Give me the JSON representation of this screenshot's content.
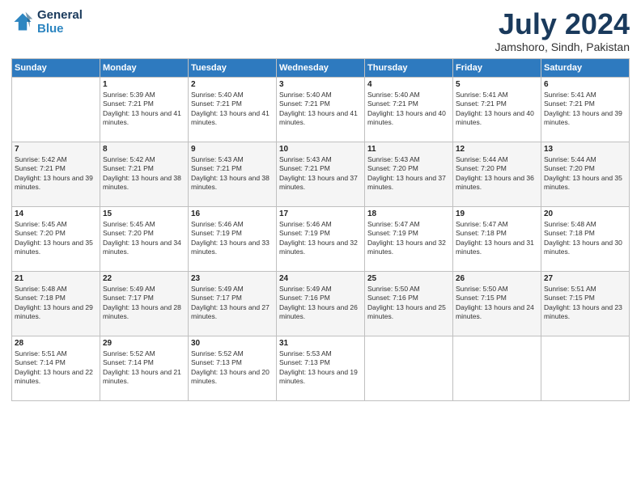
{
  "logo": {
    "line1": "General",
    "line2": "Blue"
  },
  "title": "July 2024",
  "subtitle": "Jamshoro, Sindh, Pakistan",
  "columns": [
    "Sunday",
    "Monday",
    "Tuesday",
    "Wednesday",
    "Thursday",
    "Friday",
    "Saturday"
  ],
  "weeks": [
    [
      {
        "day": "",
        "sunrise": "",
        "sunset": "",
        "daylight": ""
      },
      {
        "day": "1",
        "sunrise": "Sunrise: 5:39 AM",
        "sunset": "Sunset: 7:21 PM",
        "daylight": "Daylight: 13 hours and 41 minutes."
      },
      {
        "day": "2",
        "sunrise": "Sunrise: 5:40 AM",
        "sunset": "Sunset: 7:21 PM",
        "daylight": "Daylight: 13 hours and 41 minutes."
      },
      {
        "day": "3",
        "sunrise": "Sunrise: 5:40 AM",
        "sunset": "Sunset: 7:21 PM",
        "daylight": "Daylight: 13 hours and 41 minutes."
      },
      {
        "day": "4",
        "sunrise": "Sunrise: 5:40 AM",
        "sunset": "Sunset: 7:21 PM",
        "daylight": "Daylight: 13 hours and 40 minutes."
      },
      {
        "day": "5",
        "sunrise": "Sunrise: 5:41 AM",
        "sunset": "Sunset: 7:21 PM",
        "daylight": "Daylight: 13 hours and 40 minutes."
      },
      {
        "day": "6",
        "sunrise": "Sunrise: 5:41 AM",
        "sunset": "Sunset: 7:21 PM",
        "daylight": "Daylight: 13 hours and 39 minutes."
      }
    ],
    [
      {
        "day": "7",
        "sunrise": "Sunrise: 5:42 AM",
        "sunset": "Sunset: 7:21 PM",
        "daylight": "Daylight: 13 hours and 39 minutes."
      },
      {
        "day": "8",
        "sunrise": "Sunrise: 5:42 AM",
        "sunset": "Sunset: 7:21 PM",
        "daylight": "Daylight: 13 hours and 38 minutes."
      },
      {
        "day": "9",
        "sunrise": "Sunrise: 5:43 AM",
        "sunset": "Sunset: 7:21 PM",
        "daylight": "Daylight: 13 hours and 38 minutes."
      },
      {
        "day": "10",
        "sunrise": "Sunrise: 5:43 AM",
        "sunset": "Sunset: 7:21 PM",
        "daylight": "Daylight: 13 hours and 37 minutes."
      },
      {
        "day": "11",
        "sunrise": "Sunrise: 5:43 AM",
        "sunset": "Sunset: 7:20 PM",
        "daylight": "Daylight: 13 hours and 37 minutes."
      },
      {
        "day": "12",
        "sunrise": "Sunrise: 5:44 AM",
        "sunset": "Sunset: 7:20 PM",
        "daylight": "Daylight: 13 hours and 36 minutes."
      },
      {
        "day": "13",
        "sunrise": "Sunrise: 5:44 AM",
        "sunset": "Sunset: 7:20 PM",
        "daylight": "Daylight: 13 hours and 35 minutes."
      }
    ],
    [
      {
        "day": "14",
        "sunrise": "Sunrise: 5:45 AM",
        "sunset": "Sunset: 7:20 PM",
        "daylight": "Daylight: 13 hours and 35 minutes."
      },
      {
        "day": "15",
        "sunrise": "Sunrise: 5:45 AM",
        "sunset": "Sunset: 7:20 PM",
        "daylight": "Daylight: 13 hours and 34 minutes."
      },
      {
        "day": "16",
        "sunrise": "Sunrise: 5:46 AM",
        "sunset": "Sunset: 7:19 PM",
        "daylight": "Daylight: 13 hours and 33 minutes."
      },
      {
        "day": "17",
        "sunrise": "Sunrise: 5:46 AM",
        "sunset": "Sunset: 7:19 PM",
        "daylight": "Daylight: 13 hours and 32 minutes."
      },
      {
        "day": "18",
        "sunrise": "Sunrise: 5:47 AM",
        "sunset": "Sunset: 7:19 PM",
        "daylight": "Daylight: 13 hours and 32 minutes."
      },
      {
        "day": "19",
        "sunrise": "Sunrise: 5:47 AM",
        "sunset": "Sunset: 7:18 PM",
        "daylight": "Daylight: 13 hours and 31 minutes."
      },
      {
        "day": "20",
        "sunrise": "Sunrise: 5:48 AM",
        "sunset": "Sunset: 7:18 PM",
        "daylight": "Daylight: 13 hours and 30 minutes."
      }
    ],
    [
      {
        "day": "21",
        "sunrise": "Sunrise: 5:48 AM",
        "sunset": "Sunset: 7:18 PM",
        "daylight": "Daylight: 13 hours and 29 minutes."
      },
      {
        "day": "22",
        "sunrise": "Sunrise: 5:49 AM",
        "sunset": "Sunset: 7:17 PM",
        "daylight": "Daylight: 13 hours and 28 minutes."
      },
      {
        "day": "23",
        "sunrise": "Sunrise: 5:49 AM",
        "sunset": "Sunset: 7:17 PM",
        "daylight": "Daylight: 13 hours and 27 minutes."
      },
      {
        "day": "24",
        "sunrise": "Sunrise: 5:49 AM",
        "sunset": "Sunset: 7:16 PM",
        "daylight": "Daylight: 13 hours and 26 minutes."
      },
      {
        "day": "25",
        "sunrise": "Sunrise: 5:50 AM",
        "sunset": "Sunset: 7:16 PM",
        "daylight": "Daylight: 13 hours and 25 minutes."
      },
      {
        "day": "26",
        "sunrise": "Sunrise: 5:50 AM",
        "sunset": "Sunset: 7:15 PM",
        "daylight": "Daylight: 13 hours and 24 minutes."
      },
      {
        "day": "27",
        "sunrise": "Sunrise: 5:51 AM",
        "sunset": "Sunset: 7:15 PM",
        "daylight": "Daylight: 13 hours and 23 minutes."
      }
    ],
    [
      {
        "day": "28",
        "sunrise": "Sunrise: 5:51 AM",
        "sunset": "Sunset: 7:14 PM",
        "daylight": "Daylight: 13 hours and 22 minutes."
      },
      {
        "day": "29",
        "sunrise": "Sunrise: 5:52 AM",
        "sunset": "Sunset: 7:14 PM",
        "daylight": "Daylight: 13 hours and 21 minutes."
      },
      {
        "day": "30",
        "sunrise": "Sunrise: 5:52 AM",
        "sunset": "Sunset: 7:13 PM",
        "daylight": "Daylight: 13 hours and 20 minutes."
      },
      {
        "day": "31",
        "sunrise": "Sunrise: 5:53 AM",
        "sunset": "Sunset: 7:13 PM",
        "daylight": "Daylight: 13 hours and 19 minutes."
      },
      {
        "day": "",
        "sunrise": "",
        "sunset": "",
        "daylight": ""
      },
      {
        "day": "",
        "sunrise": "",
        "sunset": "",
        "daylight": ""
      },
      {
        "day": "",
        "sunrise": "",
        "sunset": "",
        "daylight": ""
      }
    ]
  ]
}
